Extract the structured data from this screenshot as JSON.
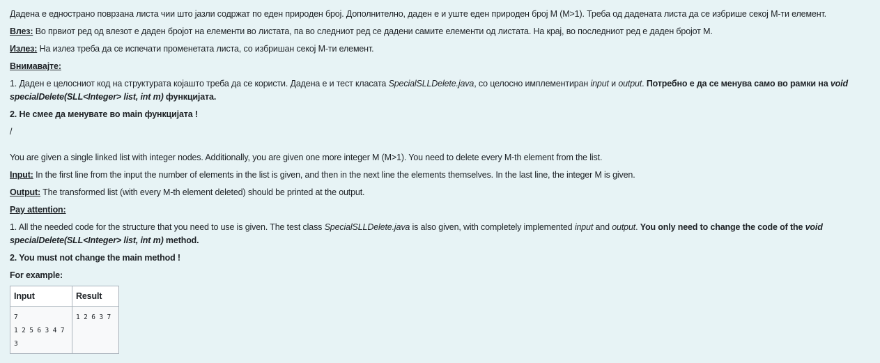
{
  "mk": {
    "p1": "Дадена е еднострано поврзана листа чии што јазли содржат по еден природен број. Дополнително, даден е и уште еден природен број M (M>1). Треба од дадената листа да се избрише секој M-ти елемент.",
    "input_label": "Влез:",
    "input_text": " Во првиот ред од влезот е даден бројот на елементи во листата, па во следниот ред се дадени самите елементи од листата. На крај, во последниот ред е даден бројот M.",
    "output_label": "Излез:",
    "output_text": " На излез треба да се испечати променетата листа, со избришан секој M-ти елемент.",
    "attention_label": "Внимавајте:",
    "n1_a": "1. Даден е целосниот код на структурата којашто треба да се користи. Дадена е и тест класата ",
    "n1_class": "SpecialSLLDelete.java",
    "n1_b": ", со целосно имплементиран ",
    "n1_input": "input",
    "n1_c": " и ",
    "n1_output": "output",
    "n1_d": ". ",
    "n1_bold": "Потребно е да се менува само во рамки на ",
    "n1_method": "void specialDelete(SLL<Integer> list, int m)",
    "n1_end": " функцијата.",
    "n2": "2. Не смее да менувате во main функцијата !",
    "slash": "/"
  },
  "en": {
    "p1": "You are given a single linked list with integer nodes. Additionally, you are given one more integer M (M>1). You need to delete every M-th element from the list.",
    "input_label": "Input:",
    "input_text": " In the first line from the input the number of elements in the list is given, and then in the next line the elements themselves. In the last line, the integer M is given.",
    "output_label": "Output:",
    "output_text": " The transformed list (with every M-th element deleted) should be printed at the output.",
    "attention_label": "Pay attention:",
    "n1_a": "1. All the needed code for the structure that you need to use is given. The test class ",
    "n1_class": "SpecialSLLDelete.java",
    "n1_b": " is also given, with completely implemented ",
    "n1_input": "input",
    "n1_c": " and ",
    "n1_output": "output",
    "n1_d": ". ",
    "n1_bold": "You only need to change the code of the ",
    "n1_method": "void specialDelete(SLL<Integer> list, int m)",
    "n1_end": " method.",
    "n2": "2. You must not change the main method !",
    "example_label": "For example:"
  },
  "example": {
    "headers": [
      "Input",
      "Result"
    ],
    "input": "7\n1 2 5 6 3 4 7\n3",
    "result": "1 2 6 3 7"
  }
}
